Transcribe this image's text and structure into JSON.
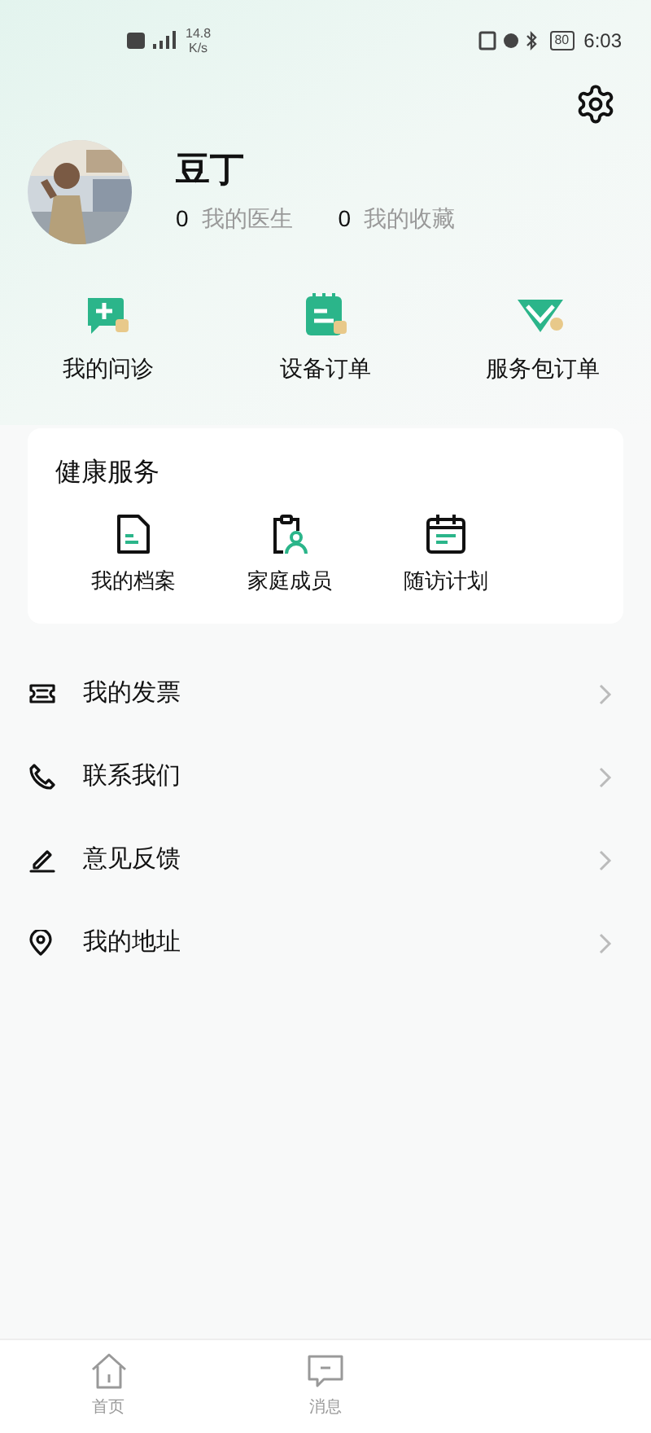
{
  "status_bar": {
    "speed": "14.8",
    "speed_unit": "K/s",
    "battery": "80",
    "time": "6:03"
  },
  "profile": {
    "name": "豆丁",
    "stats": [
      {
        "count": "0",
        "label": "我的医生"
      },
      {
        "count": "0",
        "label": "我的收藏"
      }
    ]
  },
  "shortcuts": [
    {
      "kind": "consult",
      "label": "我的问诊"
    },
    {
      "kind": "device",
      "label": "设备订单"
    },
    {
      "kind": "package",
      "label": "服务包订单"
    }
  ],
  "health_services": {
    "title": "健康服务",
    "items": [
      {
        "kind": "file",
        "label": "我的档案"
      },
      {
        "kind": "family",
        "label": "家庭成员"
      },
      {
        "kind": "calendar",
        "label": "随访计划"
      }
    ]
  },
  "menu": [
    {
      "kind": "ticket",
      "label": "我的发票"
    },
    {
      "kind": "phone",
      "label": "联系我们"
    },
    {
      "kind": "edit",
      "label": "意见反馈"
    },
    {
      "kind": "location",
      "label": "我的地址"
    }
  ],
  "tab_bar": [
    {
      "kind": "home",
      "label": "首页"
    },
    {
      "kind": "message",
      "label": "消息"
    }
  ]
}
